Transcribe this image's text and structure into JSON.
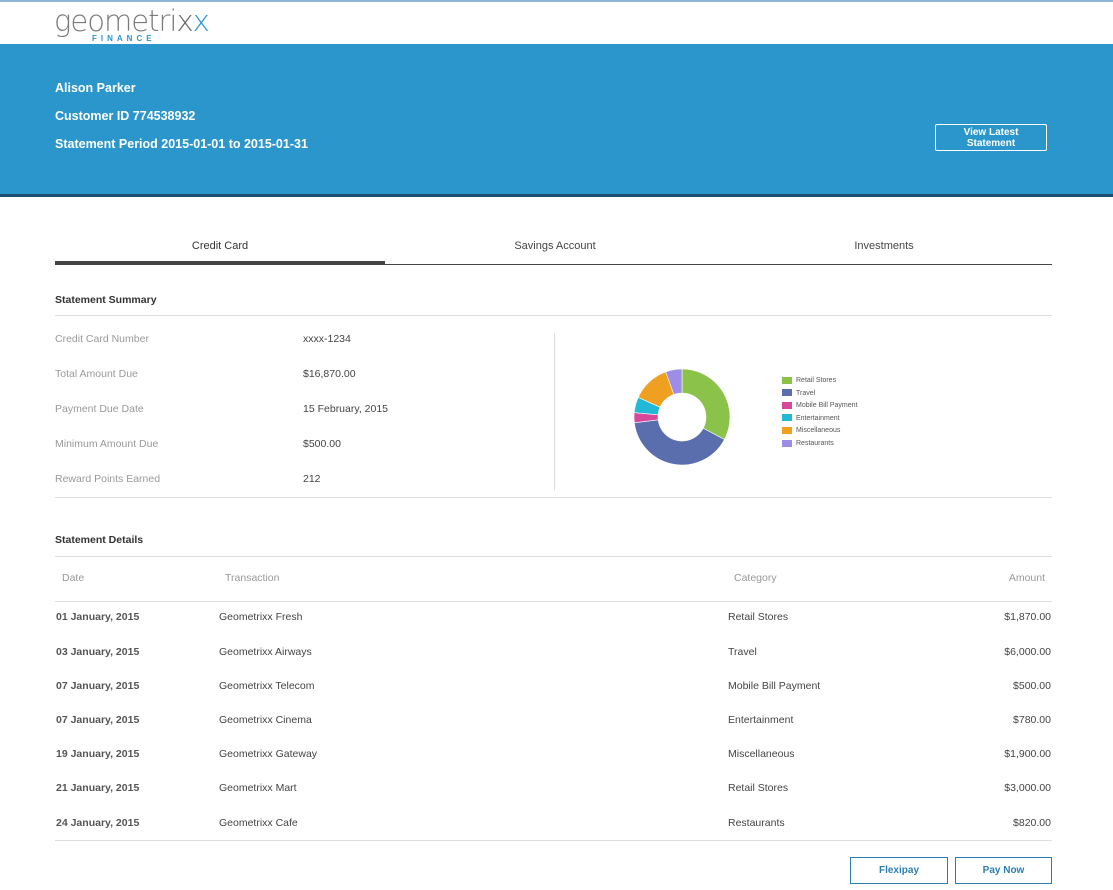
{
  "brand": {
    "name_part1": "geometri",
    "name_x1": "x",
    "name_x2": "x",
    "sub": "FINANCE"
  },
  "customer": {
    "name": "Alison Parker",
    "customer_id": "Customer ID 774538932",
    "statement_period": "Statement Period 2015-01-01 to 2015-01-31",
    "view_button": "View Latest Statement"
  },
  "tabs": [
    {
      "label": "Credit Card",
      "active": true
    },
    {
      "label": "Savings Account",
      "active": false
    },
    {
      "label": "Investments",
      "active": false
    }
  ],
  "summary": {
    "title": "Statement Summary",
    "rows": [
      {
        "label": "Credit Card Number",
        "value": "xxxx-1234"
      },
      {
        "label": "Total Amount Due",
        "value": "$16,870.00"
      },
      {
        "label": "Payment Due Date",
        "value": "15 February, 2015"
      },
      {
        "label": "Minimum Amount Due",
        "value": "$500.00"
      },
      {
        "label": "Reward Points Earned",
        "value": "212"
      }
    ]
  },
  "chart_data": {
    "type": "pie",
    "title": "",
    "categories": [
      "Retail Stores",
      "Travel",
      "Mobile Bill Payment",
      "Entertainment",
      "Miscellaneous",
      "Restaurants"
    ],
    "values": [
      4870,
      6000,
      500,
      780,
      1900,
      820
    ],
    "colors": [
      "#8bc34a",
      "#5a6eae",
      "#d6489a",
      "#22b8d6",
      "#f0a020",
      "#9d8de6"
    ],
    "legend_position": "right"
  },
  "details": {
    "title": "Statement Details",
    "columns": [
      "Date",
      "Transaction",
      "Category",
      "Amount"
    ],
    "rows": [
      {
        "date": "01 January, 2015",
        "transaction": "Geometrixx Fresh",
        "category": "Retail Stores",
        "amount": "$1,870.00"
      },
      {
        "date": "03 January, 2015",
        "transaction": "Geometrixx Airways",
        "category": "Travel",
        "amount": "$6,000.00"
      },
      {
        "date": "07 January, 2015",
        "transaction": "Geometrixx Telecom",
        "category": "Mobile Bill Payment",
        "amount": "$500.00"
      },
      {
        "date": "07 January, 2015",
        "transaction": "Geometrixx Cinema",
        "category": "Entertainment",
        "amount": "$780.00"
      },
      {
        "date": "19 January, 2015",
        "transaction": "Geometrixx Gateway",
        "category": "Miscellaneous",
        "amount": "$1,900.00"
      },
      {
        "date": "21 January, 2015",
        "transaction": "Geometrixx Mart",
        "category": "Retail Stores",
        "amount": "$3,000.00"
      },
      {
        "date": "24 January, 2015",
        "transaction": "Geometrixx Cafe",
        "category": "Restaurants",
        "amount": "$820.00"
      }
    ]
  },
  "actions": {
    "flexipay": "Flexipay",
    "pay_now": "Pay Now"
  }
}
